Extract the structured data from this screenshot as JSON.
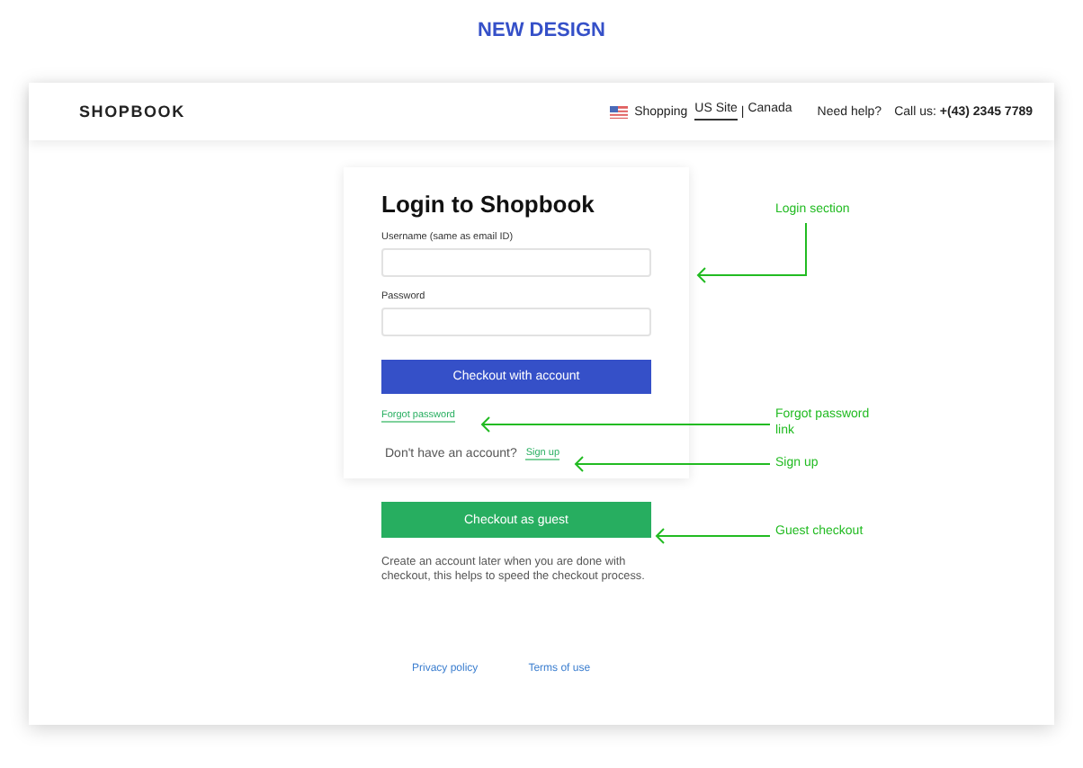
{
  "heading": "NEW DESIGN",
  "header": {
    "logo": "SHOPBOOK",
    "shopping": "Shopping",
    "sites": [
      {
        "label": "US Site",
        "selected": true
      },
      {
        "label": "Canada",
        "selected": false
      }
    ],
    "separator": "|",
    "help": "Need help?",
    "call_label": "Call us:",
    "phone": "+(43) 2345 7789"
  },
  "login": {
    "title": "Login to Shopbook",
    "fields": [
      {
        "label": "Username (same as email ID)"
      },
      {
        "label": "Password"
      }
    ],
    "submit": "Checkout with account",
    "forgot": "Forgot password",
    "no_account": "Don't have an account?",
    "signup": "Sign up"
  },
  "guest": {
    "button": "Checkout as guest",
    "note": "Create an account later when you are done with checkout, this helps to speed the checkout process."
  },
  "footer": [
    "Privacy policy",
    "Terms of use"
  ],
  "annotations": [
    {
      "kind": "elbow",
      "text": "Login section"
    },
    {
      "kind": "straight",
      "text": "Forgot password link"
    },
    {
      "kind": "straight",
      "text": "Sign up"
    },
    {
      "kind": "straight",
      "text": "Guest checkout"
    }
  ]
}
